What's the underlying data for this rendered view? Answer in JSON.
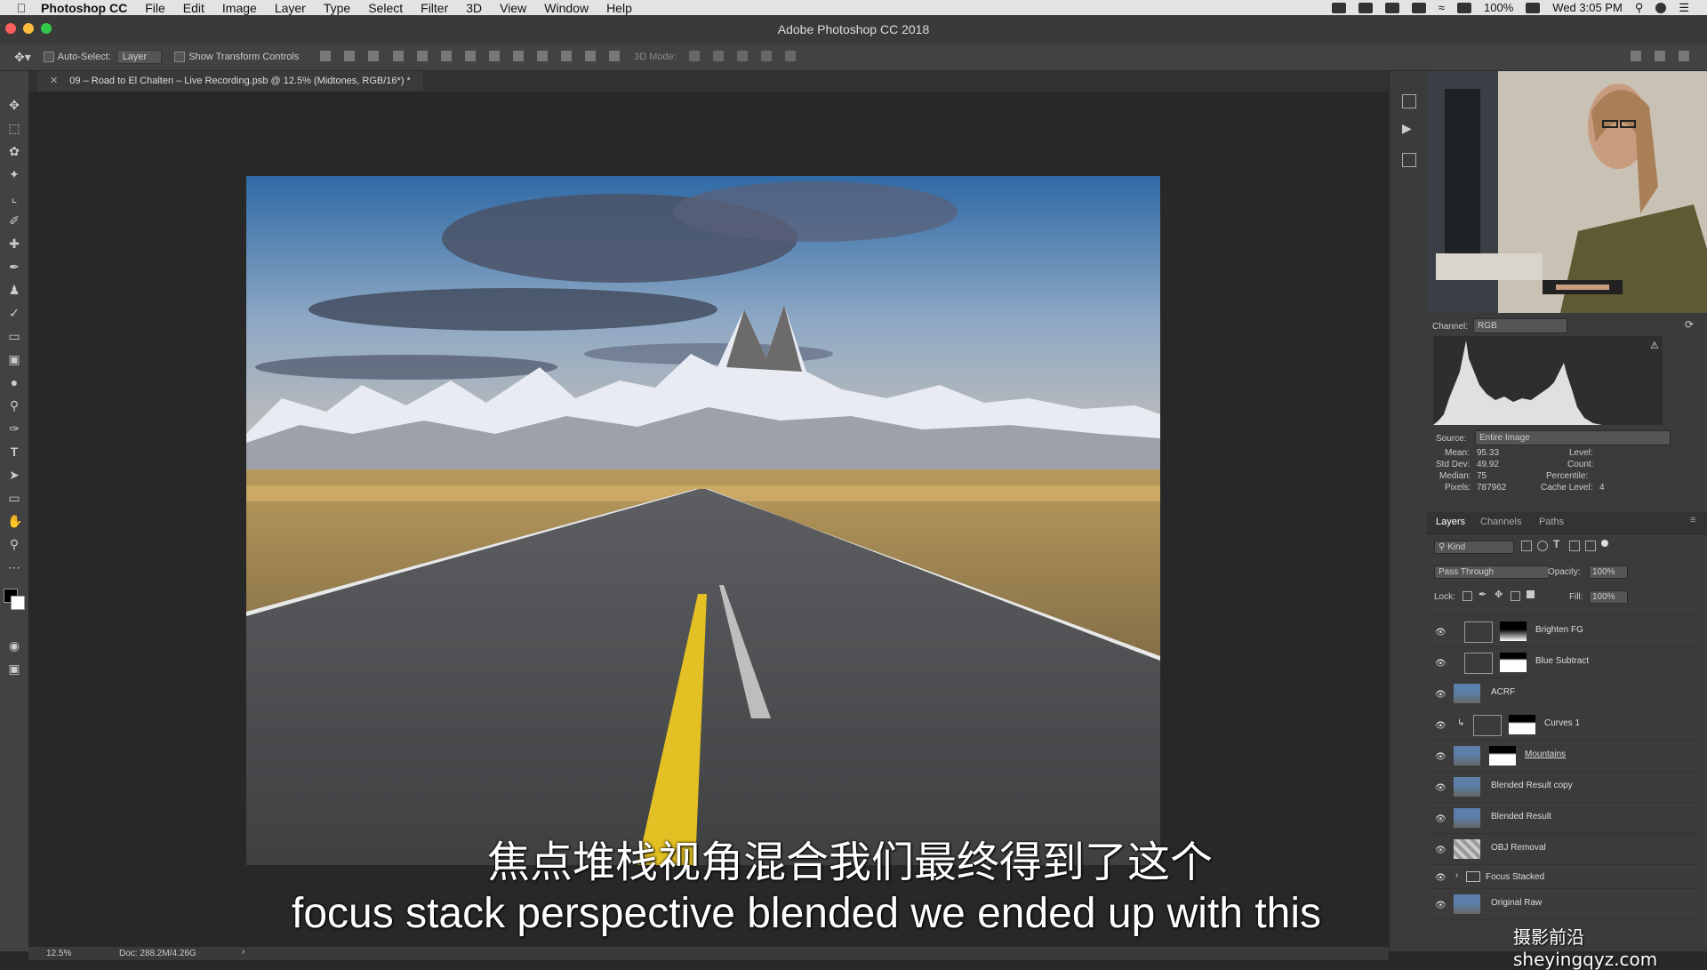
{
  "menubar": {
    "app": "Photoshop CC",
    "items": [
      "File",
      "Edit",
      "Image",
      "Layer",
      "Type",
      "Select",
      "Filter",
      "3D",
      "View",
      "Window",
      "Help"
    ],
    "battery": "100%",
    "clock": "Wed 3:05 PM"
  },
  "window": {
    "title": "Adobe Photoshop CC 2018"
  },
  "options": {
    "auto_select_label": "Auto-Select:",
    "auto_select_value": "Layer",
    "show_transform_label": "Show Transform Controls",
    "mode_3d_label": "3D Mode:"
  },
  "document": {
    "tab_label": "09 – Road to El Chalten – Live Recording.psb @ 12.5% (Midtones, RGB/16*) *"
  },
  "status": {
    "zoom": "12.5%",
    "doc": "Doc: 288.2M/4.26G"
  },
  "histogram": {
    "channel_label": "Channel:",
    "channel_value": "RGB",
    "source_label": "Source:",
    "source_value": "Entire Image",
    "stats": {
      "mean_label": "Mean:",
      "mean": "95.33",
      "std_label": "Std Dev:",
      "std": "49.92",
      "median_label": "Median:",
      "median": "75",
      "pixels_label": "Pixels:",
      "pixels": "787962",
      "level_label": "Level:",
      "count_label": "Count:",
      "percentile_label": "Percentile:",
      "cache_label": "Cache Level:",
      "cache": "4"
    }
  },
  "layers_panel": {
    "tabs": [
      "Layers",
      "Channels",
      "Paths"
    ],
    "kind_label": "Kind",
    "blend_mode": "Pass Through",
    "opacity_label": "Opacity:",
    "opacity_value": "100%",
    "lock_label": "Lock:",
    "fill_label": "Fill:",
    "fill_value": "100%",
    "layers": [
      {
        "name": "Brighten FG"
      },
      {
        "name": "Blue Subtract"
      },
      {
        "name": "ACRF"
      },
      {
        "name": "Curves 1"
      },
      {
        "name": "Mountains"
      },
      {
        "name": "Blended Result copy"
      },
      {
        "name": "Blended Result"
      },
      {
        "name": "OBJ Removal"
      },
      {
        "name": "Focus Stacked"
      },
      {
        "name": "Original Raw"
      }
    ]
  },
  "subtitles": {
    "zh": "焦点堆栈视角混合我们最终得到了这个",
    "en": "focus stack perspective blended we ended up with this"
  },
  "watermark": "摄影前沿 sheyingqyz.com",
  "colors": {
    "ui_dark": "#282828",
    "panel": "#3b3b3b",
    "road_line": "#e3c023"
  }
}
